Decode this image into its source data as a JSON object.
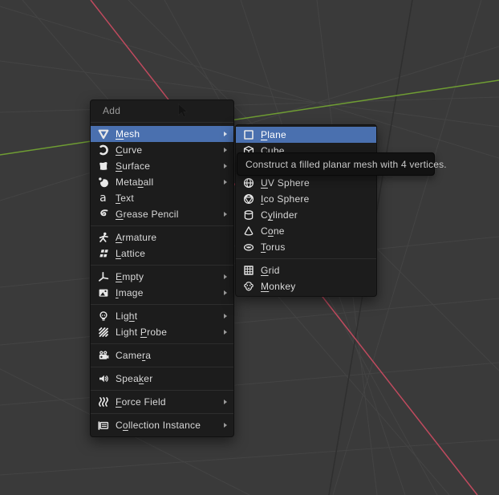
{
  "viewport": {
    "x_axis_color": "#c04a5e",
    "y_axis_color": "#6f9d33",
    "background_color": "#3a3a3a",
    "grid_color": "#444444"
  },
  "colors": {
    "menu_bg": "#1c1c1c",
    "highlight_blue": "#4a70af",
    "item_text": "#d9d9d9",
    "header_text": "#9a9a9a",
    "tooltip_bg": "#121212",
    "tooltip_text": "#c9c9c9"
  },
  "add_menu": {
    "title": "Add",
    "items": [
      {
        "label": "Mesh",
        "icon": "mesh-icon",
        "accel_index": 0,
        "submenu": true,
        "highlighted": true
      },
      {
        "label": "Curve",
        "icon": "curve-icon",
        "accel_index": 0,
        "submenu": true
      },
      {
        "label": "Surface",
        "icon": "surface-icon",
        "accel_index": 0,
        "submenu": true
      },
      {
        "label": "Metaball",
        "icon": "metaball-icon",
        "accel_index": 4,
        "submenu": true
      },
      {
        "label": "Text",
        "icon": "text-icon",
        "accel_index": 0
      },
      {
        "label": "Grease Pencil",
        "icon": "grease-pencil-icon",
        "accel_index": 0,
        "submenu": true
      },
      {
        "separator": true
      },
      {
        "label": "Armature",
        "icon": "armature-icon",
        "accel_index": 0
      },
      {
        "label": "Lattice",
        "icon": "lattice-icon",
        "accel_index": 0
      },
      {
        "separator": true
      },
      {
        "label": "Empty",
        "icon": "empty-icon",
        "accel_index": 0,
        "submenu": true
      },
      {
        "label": "Image",
        "icon": "image-icon",
        "accel_index": 0,
        "submenu": true
      },
      {
        "separator": true
      },
      {
        "label": "Light",
        "icon": "light-icon",
        "accel_index": 3,
        "submenu": true
      },
      {
        "label": "Light Probe",
        "icon": "light-probe-icon",
        "accel_index": 6,
        "submenu": true
      },
      {
        "separator": true
      },
      {
        "label": "Camera",
        "icon": "camera-icon",
        "accel_index": 4
      },
      {
        "separator": true
      },
      {
        "label": "Speaker",
        "icon": "speaker-icon",
        "accel_index": 4
      },
      {
        "separator": true
      },
      {
        "label": "Force Field",
        "icon": "force-field-icon",
        "accel_index": 0,
        "submenu": true
      },
      {
        "separator": true
      },
      {
        "label": "Collection Instance",
        "icon": "collection-instance-icon",
        "accel_index": 1,
        "submenu": true
      }
    ]
  },
  "mesh_submenu": {
    "items": [
      {
        "label": "Plane",
        "icon": "plane-icon",
        "accel_index": 0,
        "highlighted": true
      },
      {
        "label": "Cube",
        "icon": "cube-icon",
        "accel_index": 0
      },
      {
        "covered_by_tooltip": true
      },
      {
        "label": "UV Sphere",
        "icon": "uv-sphere-icon",
        "accel_index": 0
      },
      {
        "label": "Ico Sphere",
        "icon": "ico-sphere-icon",
        "accel_index": 0
      },
      {
        "label": "Cylinder",
        "icon": "cylinder-icon",
        "accel_index": 1
      },
      {
        "label": "Cone",
        "icon": "cone-icon",
        "accel_index": 1
      },
      {
        "label": "Torus",
        "icon": "torus-icon",
        "accel_index": 0
      },
      {
        "separator": true
      },
      {
        "label": "Grid",
        "icon": "grid-icon",
        "accel_index": 0
      },
      {
        "label": "Monkey",
        "icon": "monkey-icon",
        "accel_index": 0
      }
    ]
  },
  "tooltip": {
    "text": "Construct a filled planar mesh with 4 vertices."
  }
}
